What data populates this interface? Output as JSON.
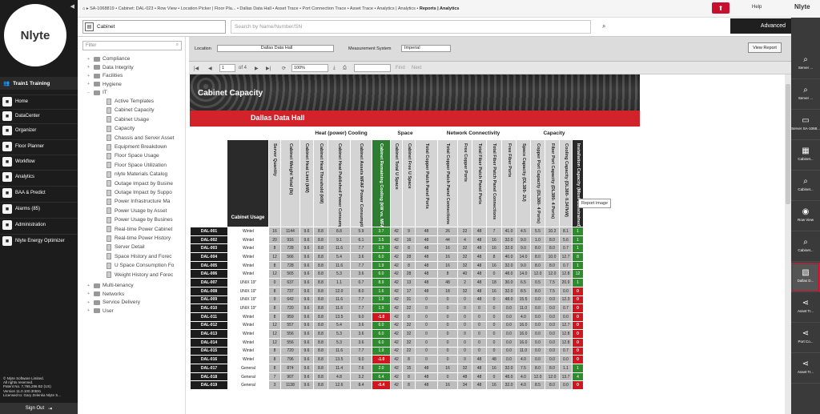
{
  "brand": {
    "logo": "Nlyte"
  },
  "user": {
    "name": "Train1 Training"
  },
  "nav": [
    {
      "label": "Home",
      "icon": "home-icon"
    },
    {
      "label": "DataCenter",
      "icon": "datacenter-icon"
    },
    {
      "label": "Organizer",
      "icon": "organizer-icon"
    },
    {
      "label": "Floor Planner",
      "icon": "floor-planner-icon"
    },
    {
      "label": "Workflow",
      "icon": "workflow-icon"
    },
    {
      "label": "Analytics",
      "icon": "analytics-icon"
    },
    {
      "label": "BAA & Predict",
      "icon": "predict-icon"
    },
    {
      "label": "Alarms (85)",
      "icon": "alarm-icon"
    },
    {
      "label": "Administration",
      "icon": "admin-icon"
    },
    {
      "label": "Nlyte Energy Optimizer",
      "icon": "energy-icon"
    }
  ],
  "footer": {
    "lines": [
      "© Nlyte Software Limited.",
      "All rights reserved.",
      "Patent No. 7,765,286 B2 (US)",
      "Version 11.0.100.30591",
      "Licensed to: Gary Zelenka Nlyte S..."
    ]
  },
  "signout": "Sign Out",
  "topbar": {
    "breadcrumb_plain": "SA-1068819 • Cabinet: DAL-023 • Row View • Location Picker | Floor Pla... • Dallas Data Hall • Asset Trace • Port Connection Trace • Asset Trace • Analytics | Analytics •",
    "breadcrumb_current": "Reports | Analytics",
    "help": "Help",
    "nlyte": "Nlyte"
  },
  "search": {
    "scope": "Cabinet",
    "placeholder": "Search by Name/Number/SN",
    "advanced": "Advanced"
  },
  "tree": {
    "filter_placeholder": "Filter",
    "top": [
      "Compliance",
      "Data Integrity",
      "Facilities",
      "Hygiene",
      "IT"
    ],
    "it_children": [
      "Active Templates",
      "Cabinet Capacity",
      "Cabinet Usage",
      "Capacity",
      "Chassis and Server Asset",
      "Equipment Breakdown",
      "Floor Space Usage",
      "Floor Space Utilization",
      "nlyte Materials Catalog",
      "Outage Impact by Busine",
      "Outage Impact by Suppo",
      "Power Infrastructure Ma",
      "Power Usage by Asset",
      "Power Usage by Busines",
      "Real-time Power Cabinet",
      "Real-time Power History",
      "Server Detail",
      "Space History and Forec",
      "U Space Consumption Fo",
      "Weight History and Forec"
    ],
    "bottom": [
      "Multi-tenancy",
      "Networks",
      "Service Delivery",
      "User"
    ]
  },
  "params": {
    "location_label": "Location",
    "location_value": "Dallas Data Hall",
    "measurement_label": "Measurement System",
    "measurement_value": "Imperial",
    "view_report": "View Report"
  },
  "toolbar": {
    "page": "1",
    "of": "of 4",
    "zoom": "100%",
    "find": "Find",
    "next": "Next"
  },
  "report": {
    "title": "Cabinet Capacity",
    "location": "Dallas Data Hall",
    "tooltip": "Report image",
    "groups": [
      "Heat (power) Cooling",
      "Space",
      "Network Connectivity",
      "Capacity"
    ],
    "usage_header": "Cabinet Usage",
    "columns": [
      "Server Quantity",
      "Cabinet Weight Total (lb)",
      "Cabinet Heat Limit (kW)",
      "Cabinet Heat Threshold (kW)",
      "Cabinet Heat Published Power Consumption (kW)",
      "Cabinet Assets MFAF Power Consumption (kW)",
      "Cabinet Remaining Cooling (kW vs. MFAF)",
      "Cabinet Total U Space",
      "Cabinet Free U Space",
      "Total Copper Patch Panel Ports",
      "Total Copper Patch Panel Connections",
      "Free Copper Ports",
      "Total Fiber Patch Panel Ports",
      "Total Fiber Patch Panel Connections",
      "Free Fiber Ports",
      "Space Capacity (DL380- 2U)",
      "Copper Port Capacity (DL380- 4 Ports)",
      "Fiber Port Capacity (DL380- 4 Ports)",
      "Cooling Capacity (DL380- 0.347kW)",
      "Installation Capacity (Most Constrained)"
    ],
    "rows": [
      [
        "DAL-001",
        "Wintel",
        "16",
        "1144",
        "9.6",
        "8.8",
        "8.8",
        "5.9",
        "3.7",
        "42",
        "9",
        "48",
        "26",
        "22",
        "48",
        "7",
        "41.0",
        "4.5",
        "5.5",
        "10.2",
        "8.1",
        "1"
      ],
      [
        "DAL-002",
        "Wintel",
        "20",
        "916",
        "9.6",
        "8.8",
        "9.1",
        "6.1",
        "3.5",
        "42",
        "16",
        "48",
        "44",
        "4",
        "48",
        "16",
        "32.0",
        "9.0",
        "1.0",
        "8.0",
        "5.6",
        "1"
      ],
      [
        "DAL-003",
        "Wintel",
        "8",
        "728",
        "9.6",
        "8.8",
        "11.6",
        "7.7",
        "1.9",
        "42",
        "8",
        "48",
        "16",
        "32",
        "48",
        "16",
        "32.0",
        "9.0",
        "8.0",
        "8.0",
        "0.7",
        "1"
      ],
      [
        "DAL-004",
        "Wintel",
        "12",
        "566",
        "9.6",
        "8.8",
        "5.4",
        "3.6",
        "6.0",
        "42",
        "28",
        "48",
        "16",
        "32",
        "48",
        "8",
        "40.0",
        "14.0",
        "8.0",
        "10.0",
        "12.7",
        "8"
      ],
      [
        "DAL-005",
        "Wintel",
        "8",
        "728",
        "9.6",
        "8.8",
        "11.6",
        "7.7",
        "1.9",
        "42",
        "8",
        "48",
        "16",
        "32",
        "48",
        "16",
        "32.0",
        "9.0",
        "8.0",
        "8.0",
        "0.7",
        "1"
      ],
      [
        "DAL-006",
        "Wintel",
        "12",
        "565",
        "9.6",
        "8.8",
        "5.3",
        "3.6",
        "6.0",
        "42",
        "28",
        "48",
        "8",
        "40",
        "48",
        "0",
        "48.0",
        "14.0",
        "12.0",
        "12.0",
        "12.8",
        "12"
      ],
      [
        "DAL-007",
        "UNIX 19\"",
        "0",
        "637",
        "9.6",
        "8.8",
        "1.1",
        "0.7",
        "8.9",
        "42",
        "13",
        "48",
        "48",
        "2",
        "48",
        "18",
        "30.0",
        "6.5",
        "0.5",
        "7.5",
        "20.9",
        "1"
      ],
      [
        "DAL-008",
        "UNIX 19\"",
        "8",
        "737",
        "9.6",
        "8.8",
        "12.0",
        "8.0",
        "1.6",
        "42",
        "17",
        "48",
        "18",
        "32",
        "48",
        "16",
        "32.0",
        "8.5",
        "8.0",
        "7.5",
        "0.0",
        "0"
      ],
      [
        "DAL-009",
        "UNIX 19\"",
        "9",
        "642",
        "9.6",
        "8.8",
        "11.6",
        "7.7",
        "1.9",
        "42",
        "31",
        "0",
        "0",
        "0",
        "48",
        "0",
        "48.0",
        "15.5",
        "0.0",
        "0.0",
        "12.3",
        "0"
      ],
      [
        "DAL-010",
        "UNIX 19\"",
        "8",
        "720",
        "9.6",
        "8.8",
        "11.6",
        "7.7",
        "1.9",
        "42",
        "22",
        "0",
        "0",
        "0",
        "0",
        "0",
        "0.0",
        "11.0",
        "0.0",
        "0.0",
        "0.7",
        "0"
      ],
      [
        "DAL-011",
        "Wintel",
        "8",
        "959",
        "9.6",
        "8.8",
        "13.5",
        "9.0",
        "-1.0",
        "42",
        "8",
        "0",
        "0",
        "0",
        "0",
        "0",
        "0.0",
        "4.0",
        "0.0",
        "0.0",
        "0.0",
        "0"
      ],
      [
        "DAL-012",
        "Wintel",
        "12",
        "557",
        "9.6",
        "8.8",
        "5.4",
        "3.6",
        "6.0",
        "42",
        "32",
        "0",
        "0",
        "0",
        "0",
        "0",
        "0.0",
        "16.0",
        "0.0",
        "0.0",
        "12.7",
        "0"
      ],
      [
        "DAL-013",
        "Wintel",
        "12",
        "556",
        "9.6",
        "8.8",
        "5.3",
        "3.6",
        "6.0",
        "42",
        "32",
        "0",
        "0",
        "0",
        "0",
        "0",
        "0.0",
        "16.0",
        "0.0",
        "0.0",
        "12.8",
        "0"
      ],
      [
        "DAL-014",
        "Wintel",
        "12",
        "556",
        "9.6",
        "8.8",
        "5.3",
        "3.6",
        "6.0",
        "42",
        "32",
        "0",
        "0",
        "0",
        "0",
        "0",
        "0.0",
        "16.0",
        "0.0",
        "0.0",
        "12.8",
        "0"
      ],
      [
        "DAL-015",
        "Wintel",
        "8",
        "720",
        "9.6",
        "8.8",
        "11.6",
        "7.7",
        "1.9",
        "42",
        "22",
        "0",
        "0",
        "0",
        "0",
        "0",
        "0.0",
        "11.0",
        "0.0",
        "0.0",
        "0.7",
        "0"
      ],
      [
        "DAL-016",
        "Wintel",
        "8",
        "796",
        "9.6",
        "8.8",
        "13.5",
        "9.0",
        "-1.0",
        "42",
        "8",
        "0",
        "0",
        "0",
        "48",
        "48",
        "0.0",
        "4.0",
        "0.0",
        "0.0",
        "0.0",
        "0"
      ],
      [
        "DAL-017",
        "General",
        "8",
        "874",
        "9.6",
        "8.8",
        "11.4",
        "7.6",
        "2.0",
        "42",
        "15",
        "48",
        "16",
        "32",
        "48",
        "16",
        "32.0",
        "7.5",
        "8.0",
        "8.0",
        "1.1",
        "1"
      ],
      [
        "DAL-018",
        "General",
        "7",
        "907",
        "9.6",
        "8.8",
        "4.8",
        "3.2",
        "6.4",
        "42",
        "8",
        "48",
        "0",
        "48",
        "48",
        "0",
        "48.0",
        "4.0",
        "12.0",
        "12.0",
        "13.7",
        "4"
      ],
      [
        "DAL-019",
        "General",
        "3",
        "1138",
        "9.6",
        "8.8",
        "12.6",
        "8.4",
        "-0.4",
        "42",
        "8",
        "48",
        "16",
        "34",
        "48",
        "16",
        "32.0",
        "4.0",
        "8.5",
        "8.0",
        "0.0",
        "0"
      ]
    ]
  },
  "right_rail": [
    {
      "label": "Server ...",
      "icon": "search-icon"
    },
    {
      "label": "Server ...",
      "icon": "search-icon"
    },
    {
      "label": "Server SA-1068...",
      "icon": "server-icon"
    },
    {
      "label": "Cabinet...",
      "icon": "cabinet-icon"
    },
    {
      "label": "Cabinet...",
      "icon": "search-icon"
    },
    {
      "label": "Row View",
      "icon": "eye-icon"
    },
    {
      "label": "Cabinet...",
      "icon": "search-icon"
    },
    {
      "label": "Dallas D...",
      "icon": "floorplan-icon"
    },
    {
      "label": "Asset Tr...",
      "icon": "share-icon"
    },
    {
      "label": "Port Co...",
      "icon": "share-icon"
    },
    {
      "label": "Asset Tr...",
      "icon": "share-icon"
    }
  ]
}
